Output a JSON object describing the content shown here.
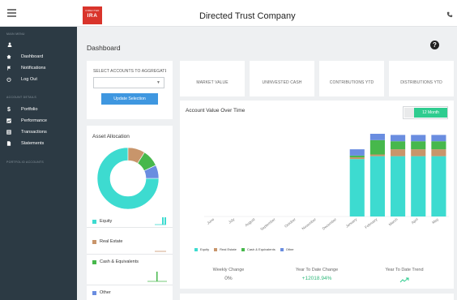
{
  "header": {
    "logo_top": "DIRECTED",
    "logo_main": "IRA",
    "title": "Directed Trust Company",
    "menu_icon": "hamburger-icon",
    "phone_icon": "phone-icon"
  },
  "sidebar": {
    "section_main": "MAIN MENU",
    "section_account": "ACCOUNT DETAILS",
    "section_portfolio": "PORTFOLIO ACCOUNTS",
    "user_icon": "user-icon",
    "items": [
      {
        "label": "Dashboard",
        "icon": "home-icon"
      },
      {
        "label": "Notifications",
        "icon": "flag-icon"
      },
      {
        "label": "Log Out",
        "icon": "power-icon"
      },
      {
        "label": "Portfolio",
        "icon": "dollar-icon"
      },
      {
        "label": "Performance",
        "icon": "chart-icon"
      },
      {
        "label": "Transactions",
        "icon": "list-icon"
      },
      {
        "label": "Statements",
        "icon": "document-icon"
      }
    ]
  },
  "page": {
    "title": "Dashboard",
    "help_icon": "help-icon"
  },
  "accounts": {
    "label": "SELECT ACCOUNTS TO AGGREGATE",
    "value": "",
    "button": "Update Selection"
  },
  "stats": [
    {
      "label": "MARKET VALUE"
    },
    {
      "label": "UNINVESTED CASH"
    },
    {
      "label": "CONTRIBUTIONS YTD"
    },
    {
      "label": "DISTRIBUTIONS YTD"
    }
  ],
  "allocation": {
    "title": "Asset Allocation",
    "items": [
      {
        "label": "Equity",
        "color": "#3ddbd0",
        "percent": 75
      },
      {
        "label": "Real Estate",
        "color": "#c8956b",
        "percent": 9
      },
      {
        "label": "Cash & Equivalents",
        "color": "#47b84c",
        "percent": 9
      },
      {
        "label": "Other",
        "color": "#6a8de0",
        "percent": 7
      }
    ]
  },
  "value_chart": {
    "title": "Account Value Over Time",
    "toggle_label": "12 Month",
    "legend": [
      {
        "label": "Equity",
        "color": "#3ddbd0"
      },
      {
        "label": "Real Estate",
        "color": "#c8956b"
      },
      {
        "label": "Cash & Equivalents",
        "color": "#47b84c"
      },
      {
        "label": "Other",
        "color": "#6a8de0"
      }
    ]
  },
  "kpis": [
    {
      "label": "Weekly Change",
      "value": "0%"
    },
    {
      "label": "Year To Date Change",
      "value": "+12018.94%"
    },
    {
      "label": "Year To Date Trend",
      "value": ""
    }
  ],
  "chart_data": [
    {
      "type": "pie",
      "title": "Asset Allocation",
      "categories": [
        "Equity",
        "Real Estate",
        "Cash & Equivalents",
        "Other"
      ],
      "values": [
        75,
        9,
        9,
        7
      ]
    },
    {
      "type": "bar",
      "title": "Account Value Over Time",
      "categories": [
        "June",
        "July",
        "August",
        "September",
        "October",
        "November",
        "December",
        "January",
        "February",
        "March",
        "April",
        "May"
      ],
      "series": [
        {
          "name": "Equity",
          "values": [
            0,
            0,
            0,
            0,
            0,
            0,
            0,
            100,
            105,
            105,
            105,
            105
          ]
        },
        {
          "name": "Real Estate",
          "values": [
            0,
            0,
            0,
            0,
            0,
            0,
            0,
            3,
            3,
            12,
            12,
            12
          ]
        },
        {
          "name": "Cash & Equivalents",
          "values": [
            0,
            0,
            0,
            0,
            0,
            0,
            0,
            3,
            25,
            14,
            14,
            14
          ]
        },
        {
          "name": "Other",
          "values": [
            0,
            0,
            0,
            0,
            0,
            0,
            0,
            11,
            11,
            11,
            11,
            11
          ]
        }
      ],
      "stacked": true,
      "grid": false
    }
  ]
}
